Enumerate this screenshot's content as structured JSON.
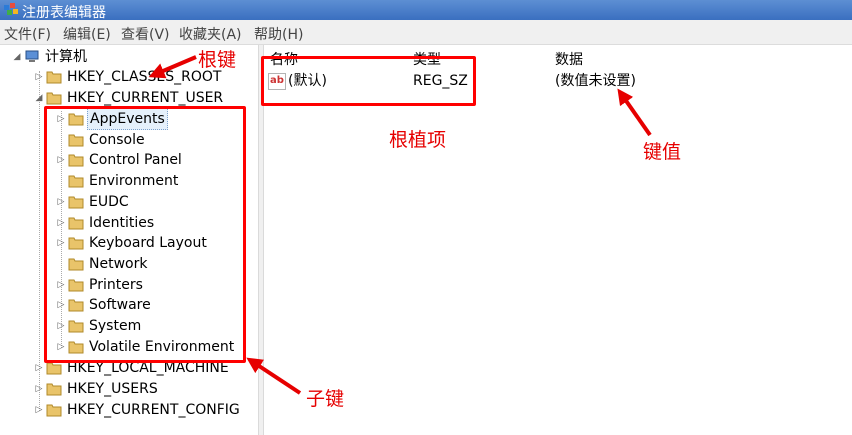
{
  "window": {
    "title": "注册表编辑器"
  },
  "menu": [
    "文件(F)",
    "编辑(E)",
    "查看(V)",
    "收藏夹(A)",
    "帮助(H)"
  ],
  "tree": {
    "root": "计算机",
    "hives_top": [
      "HKEY_CLASSES_ROOT",
      "HKEY_CURRENT_USER"
    ],
    "subkeys": [
      "AppEvents",
      "Console",
      "Control Panel",
      "Environment",
      "EUDC",
      "Identities",
      "Keyboard Layout",
      "Network",
      "Printers",
      "Software",
      "System",
      "Volatile Environment"
    ],
    "hives_bottom": [
      "HKEY_LOCAL_MACHINE",
      "HKEY_USERS",
      "HKEY_CURRENT_CONFIG"
    ]
  },
  "list": {
    "columns": [
      "名称",
      "类型",
      "数据"
    ],
    "rows": [
      {
        "name": "(默认)",
        "type": "REG_SZ",
        "data": "(数值未设置)"
      }
    ]
  },
  "annotations": {
    "root_key": "根键",
    "root_value": "根植项",
    "key_value": "键值",
    "subkey": "子键",
    "color": "#e60000"
  }
}
